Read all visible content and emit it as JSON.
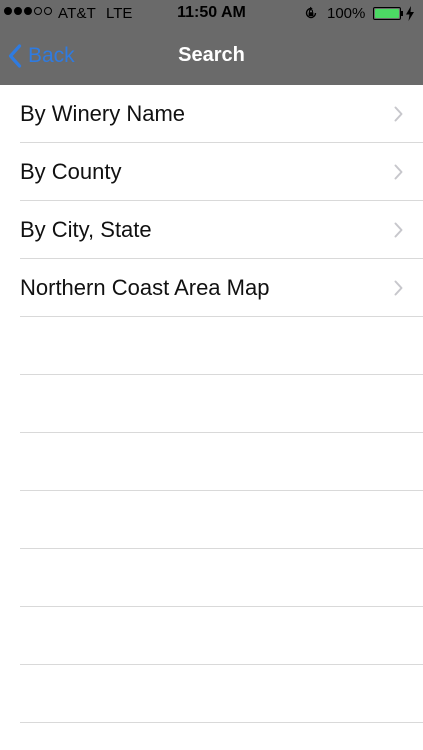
{
  "status_bar": {
    "signal_dots_filled": 3,
    "signal_dots_total": 5,
    "carrier": "AT&T",
    "network": "LTE",
    "time": "11:50 AM",
    "battery_percent": "100%",
    "battery_level": 1.0,
    "battery_color": "#4cd964",
    "icons": [
      "rotation-lock-icon",
      "battery-icon",
      "charging-bolt-icon"
    ]
  },
  "nav_bar": {
    "back_label": "Back",
    "title": "Search",
    "back_color": "#2f7be0",
    "background_color": "#6a6a6a"
  },
  "menu": {
    "items": [
      {
        "label": "By Winery Name",
        "icon": "chevron-right-icon"
      },
      {
        "label": "By County",
        "icon": "chevron-right-icon"
      },
      {
        "label": "By City, State",
        "icon": "chevron-right-icon"
      },
      {
        "label": "Northern Coast Area Map",
        "icon": "chevron-right-icon"
      }
    ]
  }
}
